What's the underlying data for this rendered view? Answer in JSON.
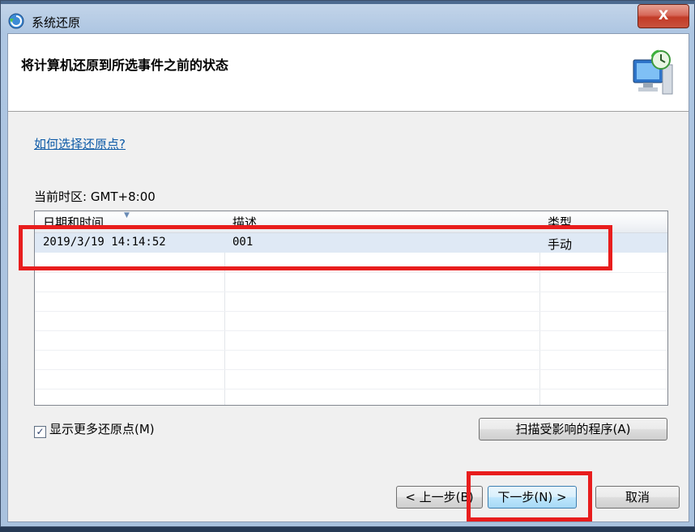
{
  "window": {
    "title": "系统还原",
    "close_label": "X"
  },
  "header": {
    "title": "将计算机还原到所选事件之前的状态"
  },
  "help_link": "如何选择还原点?",
  "timezone_label": "当前时区: GMT+8:00",
  "list": {
    "columns": [
      "日期和时间",
      "描述",
      "类型"
    ],
    "rows": [
      {
        "datetime": "2019/3/19 14:14:52",
        "description": "001",
        "type": "手动"
      }
    ]
  },
  "show_more": {
    "label": "显示更多还原点(M)",
    "checked": true
  },
  "buttons": {
    "scan": "扫描受影响的程序(A)",
    "back": "< 上一步(B)",
    "next": "下一步(N) >",
    "cancel": "取消"
  },
  "colors": {
    "annotation_red": "#e81d1d",
    "link_blue": "#0d5aa7",
    "selection": "#dfe9f5"
  }
}
